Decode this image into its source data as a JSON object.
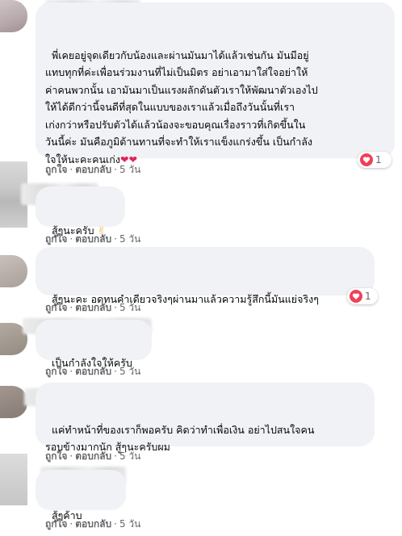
{
  "comments": [
    {
      "text": "พี่เคยอยู่จุดเดียวกับน้องและผ่านมันมาได้แล้วเช่นกัน มันมีอยู่\nแทบทุกที่ค่ะเพื่อนร่วมงานที่ไม่เป็นมิตร อย่าเอามาใส่ใจอย่าให้\nค่าคนพวกนั้น เอามันมาเป็นแรงผลักดันตัวเราให้พัฒนาตัวเองไป\nให้ได้ดีกว่านี้จนดีที่สุดในแบบของเราแล้วเมื่อถึงวันนั้นที่เรา\nเก่งกว่าหรือปรับตัวได้แล้วน้องจะขอบคุณเรื่องราวที่เกิดขึ้นใน\nวันนี้ค่ะ มันคือภูมิต้านทานที่จะทำให้เราแข็งแกร่งขึ้น เป็นกำลัง\nใจให้นะคะคนเก่ง",
      "emoji": "❤❤",
      "like": "ถูกใจ",
      "reply": "ตอบกลับ",
      "time": "5 วัน",
      "reactions": "1"
    },
    {
      "text": "สู้ๆนะครับ",
      "emoji": "✌",
      "like": "ถูกใจ",
      "reply": "ตอบกลับ",
      "time": "5 วัน"
    },
    {
      "text": "สู้ๆนะคะ อดทนคำเดียวจริงๆผ่านมาแล้วความรู้สึกนี้มันแย่จริงๆ",
      "like": "ถูกใจ",
      "reply": "ตอบกลับ",
      "time": "5 วัน",
      "reactions": "1"
    },
    {
      "text": "เป็นกำลังใจให้ครับ",
      "like": "ถูกใจ",
      "reply": "ตอบกลับ",
      "time": "5 วัน"
    },
    {
      "text": "แค่ทำหน้าที่ของเราก็พอครับ คิดว่าทำเพื่อเงิน อย่าไปสนใจคน\nรอบข้างมากนัก สู้ๆนะครับผม",
      "like": "ถูกใจ",
      "reply": "ตอบกลับ",
      "time": "5 วัน"
    },
    {
      "text": "สู้ๆค้าบ",
      "like": "ถูกใจ",
      "reply": "ตอบกลับ",
      "time": "5 วัน"
    }
  ],
  "colors": {
    "bubble": "#f0f2f5",
    "meta_text": "#65676b",
    "love_react": "#f33e58"
  },
  "icons": {
    "reaction": "heart-reaction-icon"
  }
}
